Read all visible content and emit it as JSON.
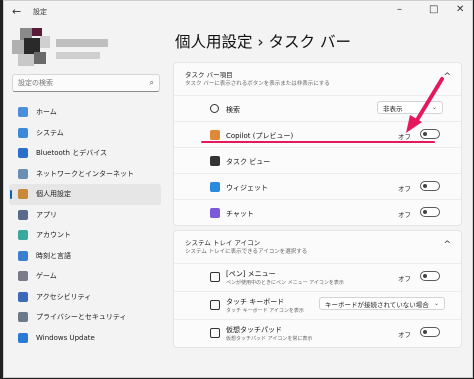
{
  "window": {
    "title": "設定",
    "back_icon": "←",
    "minimize_icon": "–",
    "maximize_icon": "□",
    "close_icon": "✕"
  },
  "search": {
    "placeholder": "設定の検索",
    "icon": "⌕"
  },
  "nav": {
    "items": [
      {
        "label": "ホーム",
        "color": "#4a8fd8",
        "active": false
      },
      {
        "label": "システム",
        "color": "#3b8ad9",
        "active": false
      },
      {
        "label": "Bluetooth とデバイス",
        "color": "#2a6fc9",
        "active": false
      },
      {
        "label": "ネットワークとインターネット",
        "color": "#6a8fb3",
        "active": false
      },
      {
        "label": "個人用設定",
        "color": "#c88a3a",
        "active": true
      },
      {
        "label": "アプリ",
        "color": "#5a6a8a",
        "active": false
      },
      {
        "label": "アカウント",
        "color": "#3aa8a0",
        "active": false
      },
      {
        "label": "時刻と言語",
        "color": "#3a7ed0",
        "active": false
      },
      {
        "label": "ゲーム",
        "color": "#7a7a8a",
        "active": false
      },
      {
        "label": "アクセシビリティ",
        "color": "#3a6ab8",
        "active": false
      },
      {
        "label": "プライバシーとセキュリティ",
        "color": "#6a7a8a",
        "active": false
      },
      {
        "label": "Windows Update",
        "color": "#2a7ad8",
        "active": false
      }
    ]
  },
  "page": {
    "title": "個人用設定 › タスク バー"
  },
  "taskbar_items": {
    "header_title": "タスク バー項目",
    "header_desc": "タスク バーに表示されるボタンを表示または非表示にする",
    "collapse_icon": "^",
    "rows": [
      {
        "label": "検索",
        "control": "dropdown",
        "value": "非表示",
        "icon_color": "#333333"
      },
      {
        "label": "Copilot (プレビュー)",
        "control": "toggle",
        "state": "オフ",
        "icon_color": "#e0883a"
      },
      {
        "label": "タスク ビュー",
        "control": "none",
        "icon_color": "#333333"
      },
      {
        "label": "ウィジェット",
        "control": "toggle",
        "state": "オフ",
        "icon_color": "#2a8ae0"
      },
      {
        "label": "チャット",
        "control": "toggle",
        "state": "オフ",
        "icon_color": "#7a5ad8"
      }
    ]
  },
  "tray": {
    "header_title": "システム トレイ アイコン",
    "header_desc": "システム トレイに表示できるアイコンを選択する",
    "collapse_icon": "^",
    "rows": [
      {
        "label": "[ペン] メニュー",
        "sub": "ペンが使用中のときにペン メニュー アイコンを表示",
        "control": "toggle",
        "state": "オフ"
      },
      {
        "label": "タッチ キーボード",
        "sub": "タッチ キーボード アイコンを表示",
        "control": "dropdown",
        "value": "キーボードが接続されていない場合"
      },
      {
        "label": "仮想タッチパッド",
        "sub": "仮想タッチパッド アイコンを常に表示",
        "control": "toggle",
        "state": "オフ"
      }
    ]
  },
  "dropdown_chevron": "⌄",
  "accent": "#e5185d"
}
